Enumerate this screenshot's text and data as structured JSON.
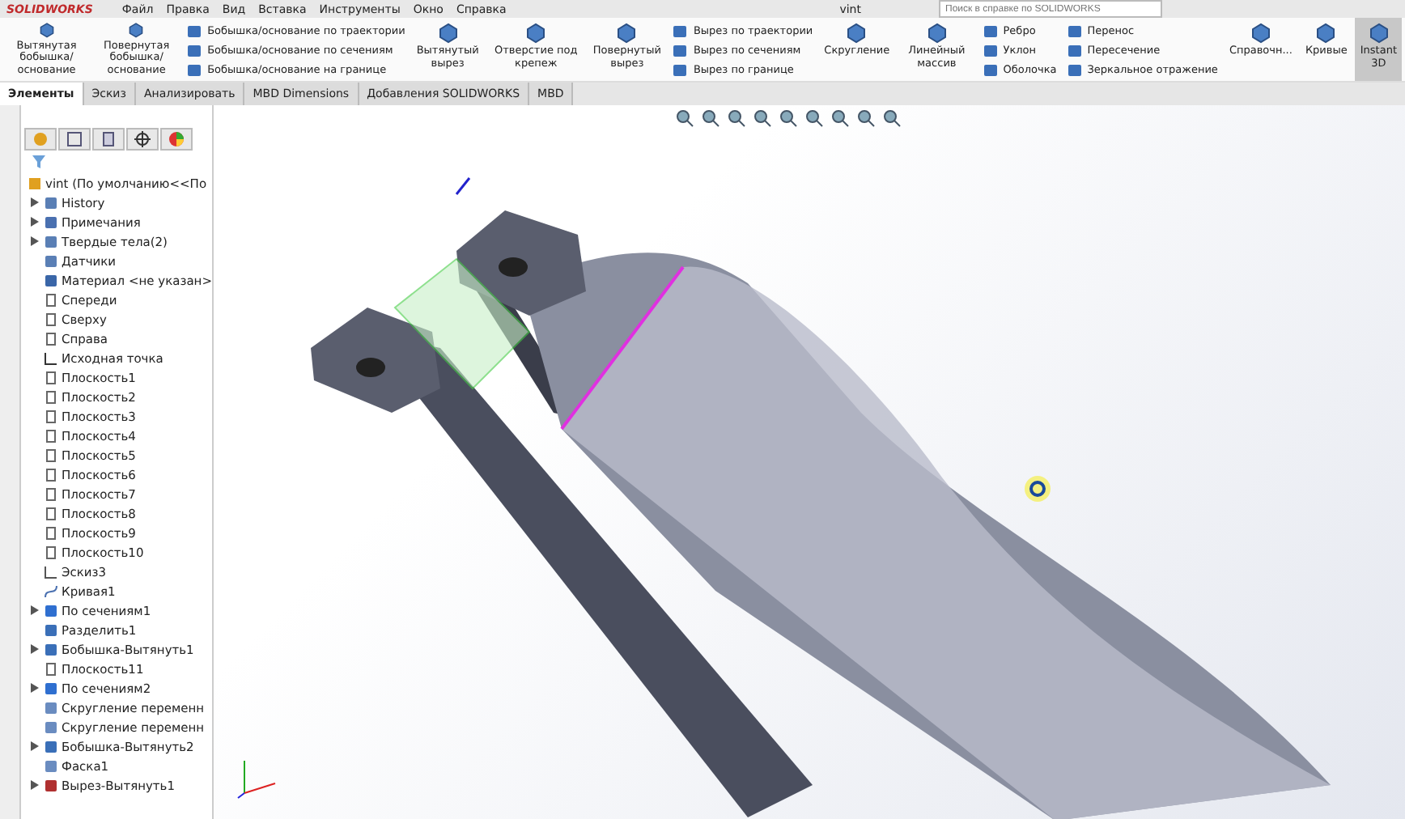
{
  "app": {
    "logo": "SOLIDWORKS",
    "title": "vint",
    "search": {
      "placeholder": "Поиск в справке по SOLIDWORKS"
    }
  },
  "menu": [
    "Файл",
    "Правка",
    "Вид",
    "Вставка",
    "Инструменты",
    "Окно",
    "Справка"
  ],
  "ribbon": [
    {
      "kind": "large",
      "label": "Вытянутая\nбобышка/основание",
      "pressed": false
    },
    {
      "kind": "large",
      "label": "Повернутая\nбобышка/основание",
      "pressed": false
    },
    {
      "kind": "stack",
      "items": [
        "Бобышка/основание по траектории",
        "Бобышка/основание по сечениям",
        "Бобышка/основание на границе"
      ]
    },
    {
      "kind": "large",
      "label": "Вытянутый\nвырез",
      "pressed": false
    },
    {
      "kind": "large",
      "label": "Отверстие под крепеж",
      "pressed": false
    },
    {
      "kind": "large",
      "label": "Повернутый\nвырез",
      "pressed": false
    },
    {
      "kind": "stack",
      "items": [
        "Вырез по траектории",
        "Вырез по сечениям",
        "Вырез по границе"
      ]
    },
    {
      "kind": "large",
      "label": "Скругление",
      "pressed": false
    },
    {
      "kind": "large",
      "label": "Линейный массив",
      "pressed": false
    },
    {
      "kind": "stack",
      "items": [
        "Ребро",
        "Уклон",
        "Оболочка"
      ]
    },
    {
      "kind": "stack",
      "items": [
        "Перенос",
        "Пересечение",
        "Зеркальное отражение"
      ]
    },
    {
      "kind": "large",
      "label": "Справочн...",
      "pressed": false
    },
    {
      "kind": "large",
      "label": "Кривые",
      "pressed": false
    },
    {
      "kind": "large",
      "label": "Instant\n3D",
      "pressed": true
    }
  ],
  "tabs": [
    {
      "label": "Элементы",
      "selected": true
    },
    {
      "label": "Эскиз",
      "selected": false
    },
    {
      "label": "Анализировать",
      "selected": false
    },
    {
      "label": "MBD Dimensions",
      "selected": false
    },
    {
      "label": "Добавления SOLIDWORKS",
      "selected": false
    },
    {
      "label": "MBD",
      "selected": false
    }
  ],
  "tree": {
    "root": "vint  (По умолчанию<<По",
    "items": [
      {
        "label": "History",
        "kind": "folder",
        "collapsed": true
      },
      {
        "label": "Примечания",
        "kind": "note",
        "collapsed": true
      },
      {
        "label": "Твердые тела(2)",
        "kind": "folder",
        "collapsed": true
      },
      {
        "label": "Датчики",
        "kind": "folder",
        "collapsed": false
      },
      {
        "label": "Материал <не указан>",
        "kind": "material",
        "collapsed": false
      },
      {
        "label": "Спереди",
        "kind": "plane",
        "collapsed": false
      },
      {
        "label": "Сверху",
        "kind": "plane",
        "collapsed": false
      },
      {
        "label": "Справа",
        "kind": "plane",
        "collapsed": false
      },
      {
        "label": "Исходная точка",
        "kind": "origin",
        "collapsed": false
      },
      {
        "label": "Плоскость1",
        "kind": "plane",
        "collapsed": false
      },
      {
        "label": "Плоскость2",
        "kind": "plane",
        "collapsed": false
      },
      {
        "label": "Плоскость3",
        "kind": "plane",
        "collapsed": false
      },
      {
        "label": "Плоскость4",
        "kind": "plane",
        "collapsed": false
      },
      {
        "label": "Плоскость5",
        "kind": "plane",
        "collapsed": false
      },
      {
        "label": "Плоскость6",
        "kind": "plane",
        "collapsed": false
      },
      {
        "label": "Плоскость7",
        "kind": "plane",
        "collapsed": false
      },
      {
        "label": "Плоскость8",
        "kind": "plane",
        "collapsed": false
      },
      {
        "label": "Плоскость9",
        "kind": "plane",
        "collapsed": false
      },
      {
        "label": "Плоскость10",
        "kind": "plane",
        "collapsed": false
      },
      {
        "label": "Эскиз3",
        "kind": "sketch",
        "collapsed": false
      },
      {
        "label": "Кривая1",
        "kind": "curve",
        "collapsed": false
      },
      {
        "label": "По сечениям1",
        "kind": "loft",
        "collapsed": true
      },
      {
        "label": "Разделить1",
        "kind": "feature",
        "collapsed": false
      },
      {
        "label": "Бобышка-Вытянуть1",
        "kind": "feature",
        "collapsed": true
      },
      {
        "label": "Плоскость11",
        "kind": "plane",
        "collapsed": false
      },
      {
        "label": "По сечениям2",
        "kind": "loft",
        "collapsed": true
      },
      {
        "label": "Скругление переменн",
        "kind": "fillet",
        "collapsed": false
      },
      {
        "label": "Скругление переменн",
        "kind": "fillet",
        "collapsed": false
      },
      {
        "label": "Бобышка-Вытянуть2",
        "kind": "feature",
        "collapsed": true
      },
      {
        "label": "Фаска1",
        "kind": "fillet",
        "collapsed": false
      },
      {
        "label": "Вырез-Вытянуть1",
        "kind": "cut",
        "collapsed": true
      }
    ]
  }
}
